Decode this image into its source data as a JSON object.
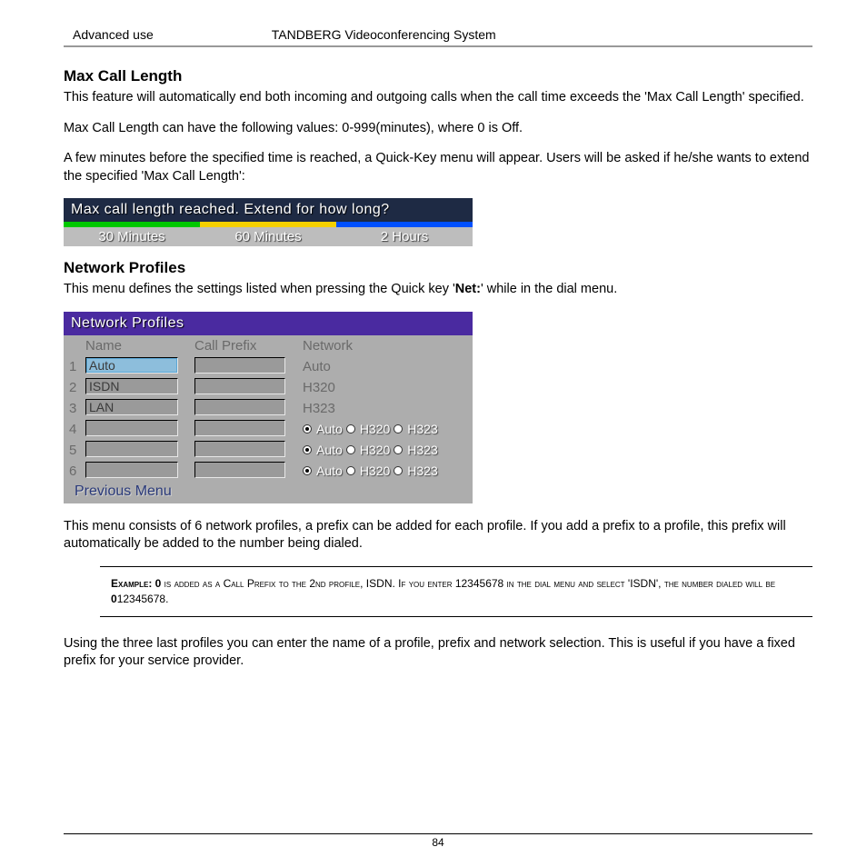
{
  "header": {
    "left": "Advanced use",
    "center": "TANDBERG Videoconferencing System"
  },
  "section1": {
    "title": "Max Call Length",
    "p1a": "This feature will automatically end both incoming and outgoing calls when the call time exceeds the 'Max Call Length' specified.",
    "p2": "Max Call Length can have the following values: 0-999(minutes), where 0 is Off.",
    "p3": "A few minutes before the specified time is reached, a Quick-Key menu will appear. Users will be asked if he/she wants to extend the specified  'Max Call Length':"
  },
  "mcl": {
    "title": "Max call length reached. Extend for how long?",
    "opt1": "30 Minutes",
    "opt2": "60 Minutes",
    "opt3": "2 Hours"
  },
  "section2": {
    "title": "Network Profiles",
    "p1a": "This menu defines the settings listed when pressing the Quick key '",
    "p1b": "Net:",
    "p1c": "' while in the dial menu."
  },
  "np": {
    "title": "Network Profiles",
    "head": {
      "name": "Name",
      "prefix": "Call Prefix",
      "network": "Network"
    },
    "rows": [
      {
        "idx": "1",
        "name": "Auto",
        "prefix": "",
        "net": "Auto",
        "fixed": true,
        "hl": true
      },
      {
        "idx": "2",
        "name": "ISDN",
        "prefix": "",
        "net": "H320",
        "fixed": true,
        "hl": false
      },
      {
        "idx": "3",
        "name": "LAN",
        "prefix": "",
        "net": "H323",
        "fixed": true,
        "hl": false
      },
      {
        "idx": "4",
        "name": "",
        "prefix": "",
        "fixed": false
      },
      {
        "idx": "5",
        "name": "",
        "prefix": "",
        "fixed": false
      },
      {
        "idx": "6",
        "name": "",
        "prefix": "",
        "fixed": false
      }
    ],
    "radio": {
      "auto": "Auto",
      "h320": "H320",
      "h323": "H323"
    },
    "prev": "Previous Menu"
  },
  "p_after_np": "This menu consists of 6 network profiles, a prefix can be added for each profile. If you add a prefix to a profile, this prefix will automatically be added to the number being dialed.",
  "example": {
    "label": "Example: 0",
    "t1": " is added as a Call Prefix to the 2nd profile, ISDN. If you enter 12345678 in the dial menu and select 'ISDN', the number dialed will be ",
    "bold": "0",
    "t2": "12345678."
  },
  "p_last": "Using the three last profiles you can enter the name of a profile, prefix and network selection. This is useful if you have a fixed prefix for your service provider.",
  "page_number": "84"
}
